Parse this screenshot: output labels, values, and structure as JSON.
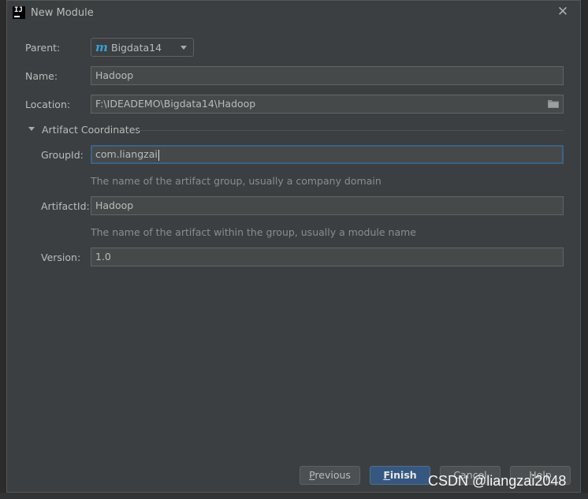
{
  "window": {
    "title": "New Module"
  },
  "form": {
    "parent_label": "Parent:",
    "parent_value": "Bigdata14",
    "name_label": "Name:",
    "name_value": "Hadoop",
    "location_label": "Location:",
    "location_value": "F:\\IDEADEMO\\Bigdata14\\Hadoop"
  },
  "artifact": {
    "section_title": "Artifact Coordinates",
    "group_label": "GroupId:",
    "group_value": "com.liangzai",
    "group_hint": "The name of the artifact group, usually a company domain",
    "artifact_label": "ArtifactId:",
    "artifact_value": "Hadoop",
    "artifact_hint": "The name of the artifact within the group, usually a module name",
    "version_label": "Version:",
    "version_value": "1.0"
  },
  "buttons": {
    "previous_mnemonic": "P",
    "previous_rest": "revious",
    "finish_mnemonic": "F",
    "finish_rest": "inish",
    "cancel": "Cancel",
    "help": "Help"
  },
  "watermark": "CSDN @liangzai2048",
  "icons": {
    "app": "intellij-icon",
    "module": "maven-module-icon",
    "folder": "folder-icon",
    "close": "close-icon"
  }
}
